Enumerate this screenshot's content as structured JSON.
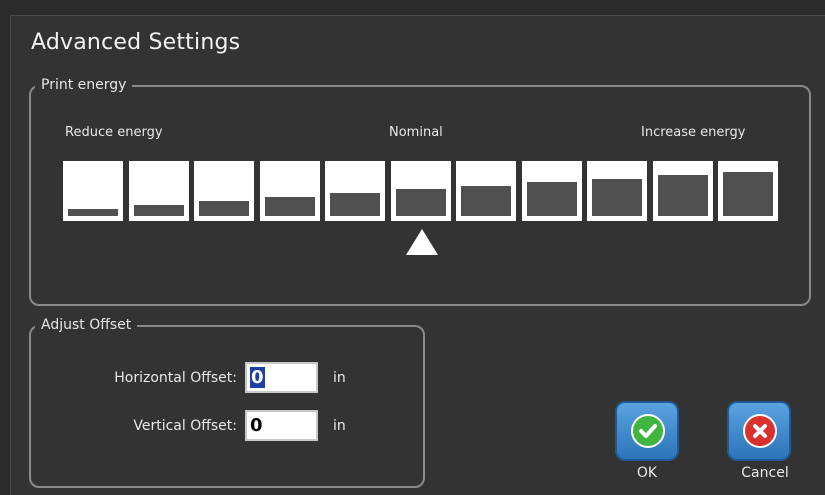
{
  "dialog": {
    "title": "Advanced Settings"
  },
  "print_energy": {
    "group_label": "Print energy",
    "reduce_label": "Reduce energy",
    "nominal_label": "Nominal",
    "increase_label": "Increase energy",
    "level_count": 11,
    "selected_level": 6,
    "fill_fractions": [
      0.13,
      0.22,
      0.3,
      0.38,
      0.46,
      0.53,
      0.6,
      0.67,
      0.74,
      0.81,
      0.87
    ]
  },
  "adjust_offset": {
    "group_label": "Adjust Offset",
    "horizontal_label": "Horizontal Offset:",
    "horizontal_value": "0",
    "horizontal_unit": "in",
    "vertical_label": "Vertical Offset:",
    "vertical_value": "0",
    "vertical_unit": "in"
  },
  "buttons": {
    "ok_label": "OK",
    "cancel_label": "Cancel",
    "ok_icon": "check-icon",
    "cancel_icon": "x-icon"
  },
  "colors": {
    "background": "#333333",
    "button_blue": "#3f8ccf",
    "ok_green": "#3fb63f",
    "cancel_red": "#d8312e"
  }
}
